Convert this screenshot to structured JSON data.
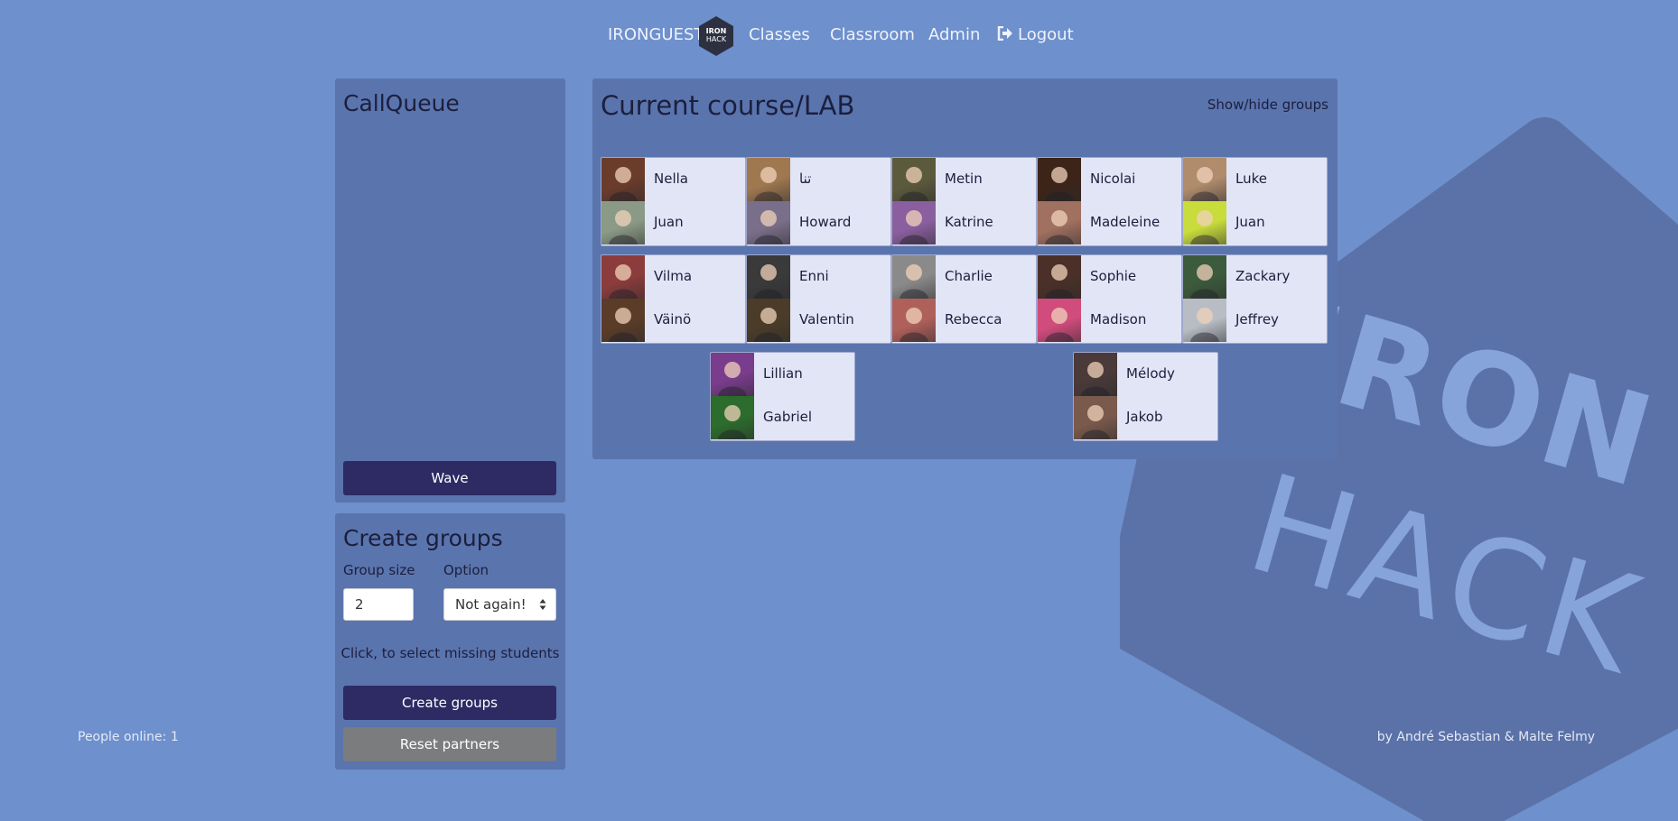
{
  "nav": {
    "brand": "IRONGUEST",
    "logo_line1": "IRON",
    "logo_line2": "HACK",
    "links": {
      "classes": "Classes",
      "classroom": "Classroom",
      "admin": "Admin",
      "logout": "Logout"
    }
  },
  "background_logo": {
    "line1": "IRON",
    "line2": "HACK"
  },
  "callqueue": {
    "title": "CallQueue",
    "wave_label": "Wave"
  },
  "create_groups": {
    "title": "Create groups",
    "group_size_label": "Group size",
    "group_size_value": "2",
    "option_label": "Option",
    "option_value": "Not again!",
    "hint": "Click, to select missing students",
    "create_label": "Create groups",
    "reset_label": "Reset partners"
  },
  "course": {
    "title": "Current course/LAB",
    "toggle_label": "Show/hide groups",
    "groups": [
      {
        "members": [
          {
            "name": "Nella",
            "avatar": "#6b3c2c"
          },
          {
            "name": "Juan",
            "avatar": "#8b9a86"
          }
        ]
      },
      {
        "members": [
          {
            "name": "تنا",
            "avatar": "#a07850"
          },
          {
            "name": "Howard",
            "avatar": "#7a6f8a"
          }
        ]
      },
      {
        "members": [
          {
            "name": "Metin",
            "avatar": "#5c5a3c"
          },
          {
            "name": "Katrine",
            "avatar": "#8a5fa0"
          }
        ]
      },
      {
        "members": [
          {
            "name": "Nicolai",
            "avatar": "#3c2418"
          },
          {
            "name": "Madeleine",
            "avatar": "#a07060"
          }
        ]
      },
      {
        "members": [
          {
            "name": "Luke",
            "avatar": "#b08c6c"
          },
          {
            "name": "Juan",
            "avatar": "#c8dc3c"
          }
        ]
      },
      {
        "members": [
          {
            "name": "Vilma",
            "avatar": "#8c3c3c"
          },
          {
            "name": "Väinö",
            "avatar": "#5a3c28"
          }
        ]
      },
      {
        "members": [
          {
            "name": "Enni",
            "avatar": "#3a3a3a"
          },
          {
            "name": "Valentin",
            "avatar": "#4a3c28"
          }
        ]
      },
      {
        "members": [
          {
            "name": "Charlie",
            "avatar": "#8a8a8a"
          },
          {
            "name": "Rebecca",
            "avatar": "#b0605a"
          }
        ]
      },
      {
        "members": [
          {
            "name": "Sophie",
            "avatar": "#4a3028"
          },
          {
            "name": "Madison",
            "avatar": "#d04c7c"
          }
        ]
      },
      {
        "members": [
          {
            "name": "Zackary",
            "avatar": "#3c5a3c"
          },
          {
            "name": "Jeffrey",
            "avatar": "#b8bcc4"
          }
        ]
      },
      {
        "members": [
          {
            "name": "Lillian",
            "avatar": "#7a3c8c"
          },
          {
            "name": "Gabriel",
            "avatar": "#2c6c2c"
          }
        ]
      },
      {
        "members": [
          {
            "name": "Mélody",
            "avatar": "#4a3a3a"
          },
          {
            "name": "Jakob",
            "avatar": "#7a5a4c"
          }
        ]
      }
    ]
  },
  "footer": {
    "online": "People online: 1",
    "credits": "by André Sebastian & Malte Felmy"
  },
  "colors": {
    "page_bg": "#6e90cc",
    "panel_bg": "#5a74ae",
    "card_bg": "#e2e5f6",
    "button_dark": "#2d2a64",
    "button_grey": "#7b7c7e",
    "logo_hex": "#5b72a8"
  },
  "icons": {
    "logout": "sign-out-icon",
    "brand": "ironhack-hex-logo",
    "select": "select-arrows-icon"
  }
}
